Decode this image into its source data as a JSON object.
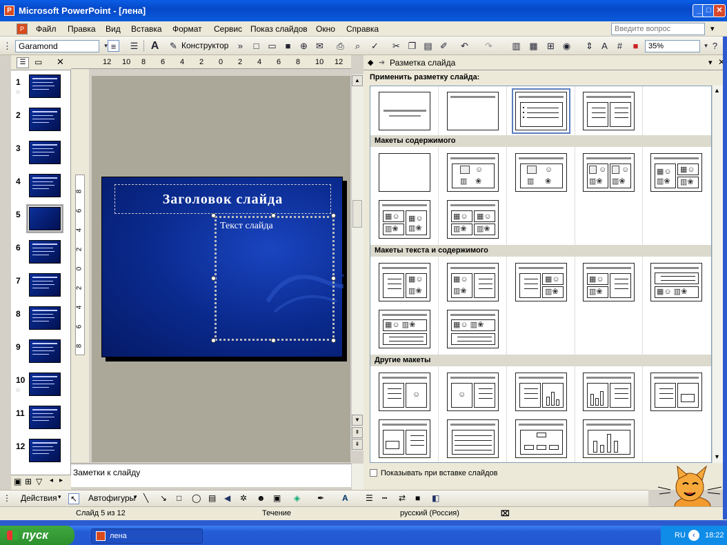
{
  "window": {
    "title": "Microsoft PowerPoint - [лена]",
    "app_icon": "powerpoint-icon"
  },
  "menu": {
    "items": [
      "Файл",
      "Правка",
      "Вид",
      "Вставка",
      "Формат",
      "Сервис",
      "Показ слайдов",
      "Окно",
      "Справка"
    ],
    "ask_placeholder": "Введите вопрос"
  },
  "toolbar": {
    "font": "Garamond",
    "designer": "Конструктор",
    "zoom": "35%"
  },
  "left_panel": {
    "slides": [
      {
        "num": "1",
        "star": true
      },
      {
        "num": "2",
        "star": false
      },
      {
        "num": "3",
        "star": false
      },
      {
        "num": "4",
        "star": false
      },
      {
        "num": "5",
        "star": false
      },
      {
        "num": "6",
        "star": false
      },
      {
        "num": "7",
        "star": false
      },
      {
        "num": "8",
        "star": false
      },
      {
        "num": "9",
        "star": false
      },
      {
        "num": "10",
        "star": true
      },
      {
        "num": "11",
        "star": false
      },
      {
        "num": "12",
        "star": false
      }
    ],
    "selected": 5
  },
  "ruler_top": [
    "12",
    "10",
    "8",
    "6",
    "4",
    "2",
    "0",
    "2",
    "4",
    "6",
    "8",
    "10",
    "12"
  ],
  "ruler_left": [
    "8",
    "6",
    "4",
    "2",
    "0",
    "2",
    "4",
    "6",
    "8"
  ],
  "slide": {
    "title": "Заголовок слайда",
    "text": "Текст слайда"
  },
  "notes": {
    "placeholder": "Заметки к слайду"
  },
  "task_pane": {
    "title": "Разметка слайда",
    "apply_label": "Применить разметку слайда:",
    "sections": {
      "content": "Макеты содержимого",
      "text_content": "Макеты текста и содержимого",
      "other": "Другие макеты"
    },
    "show_on_insert": "Показывать при вставке слайдов"
  },
  "draw_toolbar": {
    "actions": "Действия",
    "autoshapes": "Автофигуры"
  },
  "status": {
    "slide": "Слайд 5 из 12",
    "design": "Течение",
    "language": "русский (Россия)"
  },
  "taskbar": {
    "start": "пуск",
    "item": "лена",
    "lang": "RU",
    "time": "18:22"
  }
}
